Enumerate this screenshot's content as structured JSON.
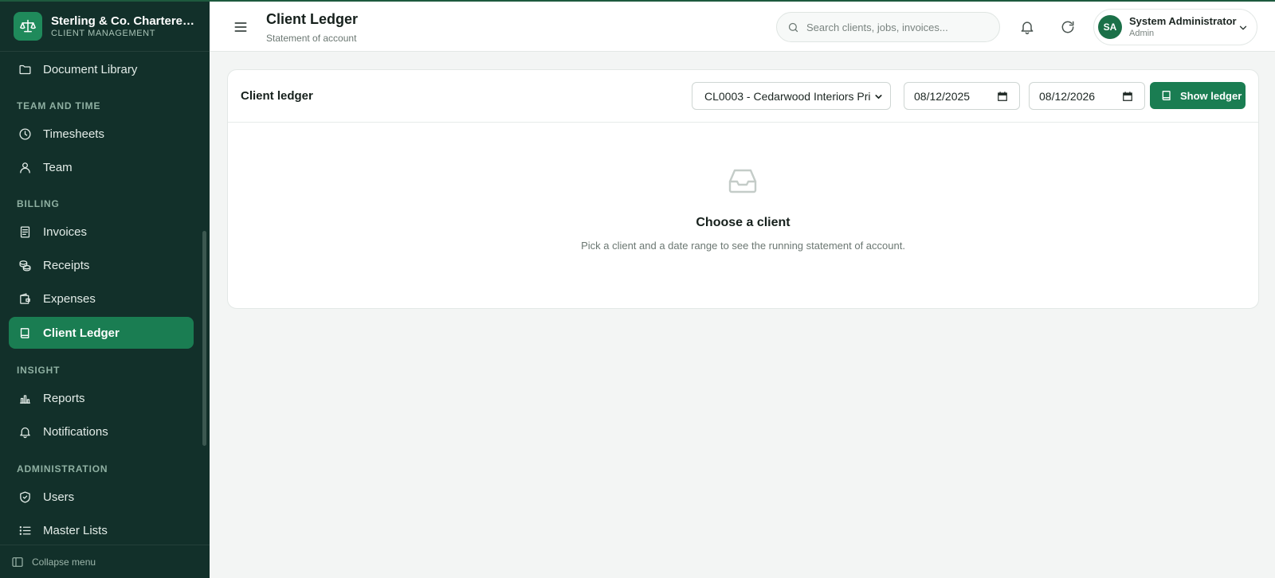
{
  "brand": {
    "name": "Sterling & Co. Chartered ...",
    "subtitle": "CLIENT MANAGEMENT"
  },
  "sidebar": {
    "items": [
      {
        "label": "Document Library",
        "icon": "folder-icon"
      },
      {
        "label": "Timesheets",
        "icon": "clock-icon"
      },
      {
        "label": "Team",
        "icon": "user-icon"
      },
      {
        "label": "Invoices",
        "icon": "invoice-icon"
      },
      {
        "label": "Receipts",
        "icon": "coins-icon"
      },
      {
        "label": "Expenses",
        "icon": "wallet-icon"
      },
      {
        "label": "Client Ledger",
        "icon": "book-icon",
        "active": true
      },
      {
        "label": "Reports",
        "icon": "bar-chart-icon"
      },
      {
        "label": "Notifications",
        "icon": "bell-icon"
      },
      {
        "label": "Users",
        "icon": "shield-icon"
      },
      {
        "label": "Master Lists",
        "icon": "list-icon"
      }
    ],
    "sections": [
      "TEAM AND TIME",
      "BILLING",
      "INSIGHT",
      "ADMINISTRATION"
    ],
    "collapse_label": "Collapse menu"
  },
  "header": {
    "title": "Client Ledger",
    "subtitle": "Statement of account",
    "search_placeholder": "Search clients, jobs, invoices...",
    "user": {
      "initials": "SA",
      "name": "System Administrator",
      "role": "Admin"
    }
  },
  "card": {
    "title": "Client ledger",
    "client_selected": "CL0003 - Cedarwood Interiors Pri",
    "date_from": "08/12/2025",
    "date_to": "08/12/2026",
    "show_button": "Show ledger",
    "empty_title": "Choose a client",
    "empty_text": "Pick a client and a date range to see the running statement of account."
  },
  "colors": {
    "sidebar_bg": "#12302a",
    "accent": "#1a7d52",
    "page_bg": "#f3f5f4"
  }
}
